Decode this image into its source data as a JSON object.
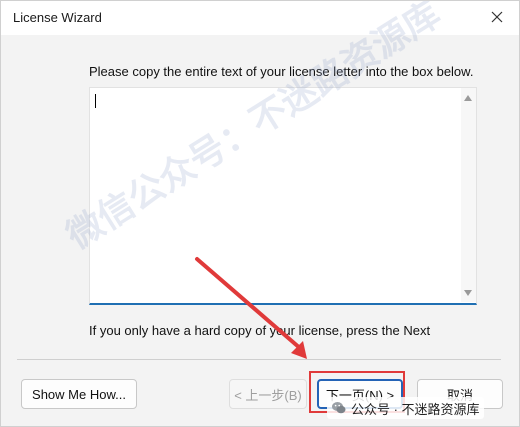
{
  "window": {
    "title": "License Wizard",
    "close_symbol": "×"
  },
  "instruction": "Please copy the entire text of your license letter into the box below.",
  "license_box": {
    "value": ""
  },
  "hint": "If you only have a hard copy of your license, press the Next",
  "buttons": {
    "show_me_how": "Show Me How...",
    "back": "< 上一步(B)",
    "next": "下一页(N) >",
    "cancel": "取消"
  },
  "watermark": "微信公众号：不迷路资源库",
  "badge": {
    "icon": "wechat-icon",
    "text": "公众号 · 不迷路资源库"
  },
  "colors": {
    "accent": "#2463b6",
    "highlight": "#e03a3a",
    "box_underline": "#1f6fb3"
  }
}
